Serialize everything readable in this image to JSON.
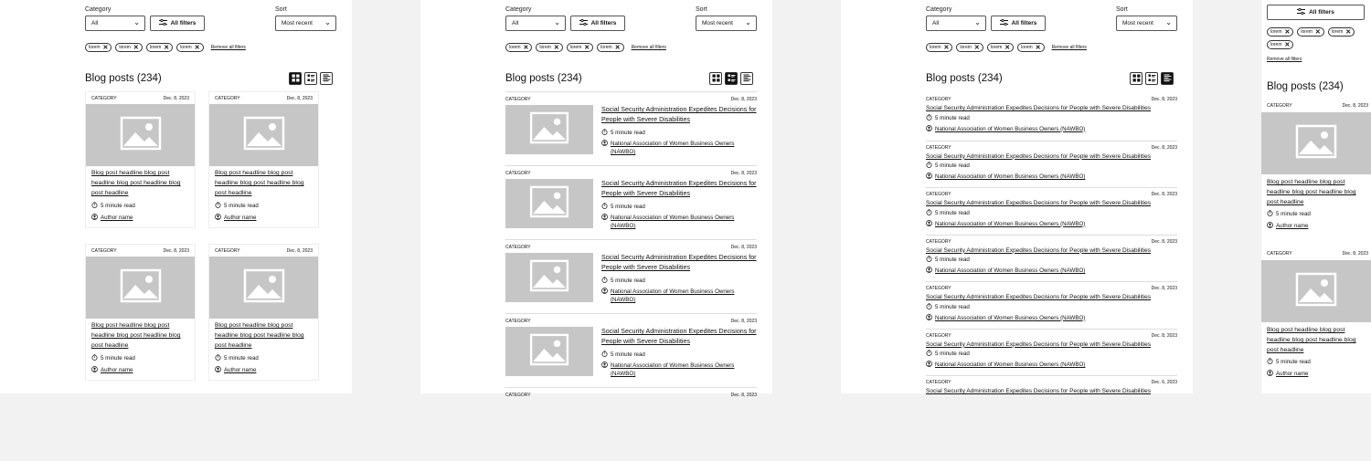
{
  "filters": {
    "category_label": "Category",
    "category_value": "All",
    "all_filters_label": "All filters",
    "sort_label": "Sort",
    "sort_value": "Most recent",
    "chips": [
      "lorem",
      "lorem",
      "lorem",
      "lorem"
    ],
    "remove_all": "Remove all filters"
  },
  "heading": "Blog posts (234)",
  "grid_cards": [
    {
      "category": "CATEGORY",
      "date": "Dec. 8, 2023",
      "title": "Blog post headline blog post headline blog post headline blog post headline",
      "read_time": "5 minute read",
      "author": "Author name"
    },
    {
      "category": "CATEGORY",
      "date": "Dec. 8, 2023",
      "title": "Blog post headline blog post headline blog post headline blog post headline",
      "read_time": "5 minute read",
      "author": "Author name"
    },
    {
      "category": "CATEGORY",
      "date": "Dec. 8, 2023",
      "title": "Blog post headline blog post headline blog post headline blog post headline",
      "read_time": "5 minute read",
      "author": "Author name"
    },
    {
      "category": "CATEGORY",
      "date": "Dec. 8, 2023",
      "title": "Blog post headline blog post headline blog post headline blog post headline",
      "read_time": "5 minute read",
      "author": "Author name"
    }
  ],
  "list_rows": [
    {
      "category": "CATEGORY",
      "date": "Dec. 8, 2023",
      "title": "Social Security Administration Expedites Decisions for People with Severe Disabilities",
      "read_time": "5 minute read",
      "author": "National Association of Women Business Owners (NAWBO)"
    },
    {
      "category": "CATEGORY",
      "date": "Dec. 8, 2023",
      "title": "Social Security Administration Expedites Decisions for People with Severe Disabilities",
      "read_time": "5 minute read",
      "author": "National Association of Women Business Owners (NAWBO)"
    },
    {
      "category": "CATEGORY",
      "date": "Dec. 8, 2023",
      "title": "Social Security Administration Expedites Decisions for People with Severe Disabilities",
      "read_time": "5 minute read",
      "author": "National Association of Women Business Owners (NAWBO)"
    },
    {
      "category": "CATEGORY",
      "date": "Dec. 8, 2023",
      "title": "Social Security Administration Expedites Decisions for People with Severe Disabilities",
      "read_time": "5 minute read",
      "author": "National Association of Women Business Owners (NAWBO)"
    },
    {
      "category": "CATEGORY",
      "date": "Dec. 8, 2023"
    }
  ],
  "compact_rows": [
    {
      "category": "CATEGORY",
      "date": "Dec. 8, 2023",
      "title": "Social Security Administration Expedites Decisions for People with Severe Disabilities",
      "read_time": "5 minute read",
      "author": "National Association of Women Business Owners (NAWBO)"
    },
    {
      "category": "CATEGORY",
      "date": "Dec. 8, 2023",
      "title": "Social Security Administration Expedites Decisions for People with Severe Disabilities",
      "read_time": "5 minute read",
      "author": "National Association of Women Business Owners (NAWBO)"
    },
    {
      "category": "CATEGORY",
      "date": "Dec. 8, 2023",
      "title": "Social Security Administration Expedites Decisions for People with Severe Disabilities",
      "read_time": "5 minute read",
      "author": "National Association of Women Business Owners (NAWBO)"
    },
    {
      "category": "CATEGORY",
      "date": "Dec. 8, 2023",
      "title": "Social Security Administration Expedites Decisions for People with Severe Disabilities",
      "read_time": "5 minute read",
      "author": "National Association of Women Business Owners (NAWBO)"
    },
    {
      "category": "CATEGORY",
      "date": "Dec. 8, 2023",
      "title": "Social Security Administration Expedites Decisions for People with Severe Disabilities",
      "read_time": "5 minute read",
      "author": "National Association of Women Business Owners (NAWBO)"
    },
    {
      "category": "CATEGORY",
      "date": "Dec. 8, 2023",
      "title": "Social Security Administration Expedites Decisions for People with Severe Disabilities",
      "read_time": "5 minute read",
      "author": "National Association of Women Business Owners (NAWBO)"
    },
    {
      "category": "CATEGORY",
      "date": "Dec. 6, 2023",
      "title": "Social Security Administration Expedites Decisions for People with Severe Disabilities"
    }
  ],
  "mobile_cards": [
    {
      "category": "CATEGORY",
      "date": "Dec. 8, 2023",
      "title": "Blog post headline blog post headline blog post headline blog post headline",
      "read_time": "5 minute read",
      "author": "Author name"
    },
    {
      "category": "CATEGORY",
      "date": "Dec. 8, 2023",
      "title": "Blog post headline blog post headline blog post headline blog post headline",
      "read_time": "5 minute read",
      "author": "Author name"
    }
  ],
  "icons": {
    "clock": "clock-icon",
    "author": "user-circle-icon",
    "image": "image-placeholder-icon",
    "filter": "sliders-icon",
    "grid": "grid-view-icon",
    "list": "list-view-icon",
    "compact": "compact-list-icon"
  }
}
